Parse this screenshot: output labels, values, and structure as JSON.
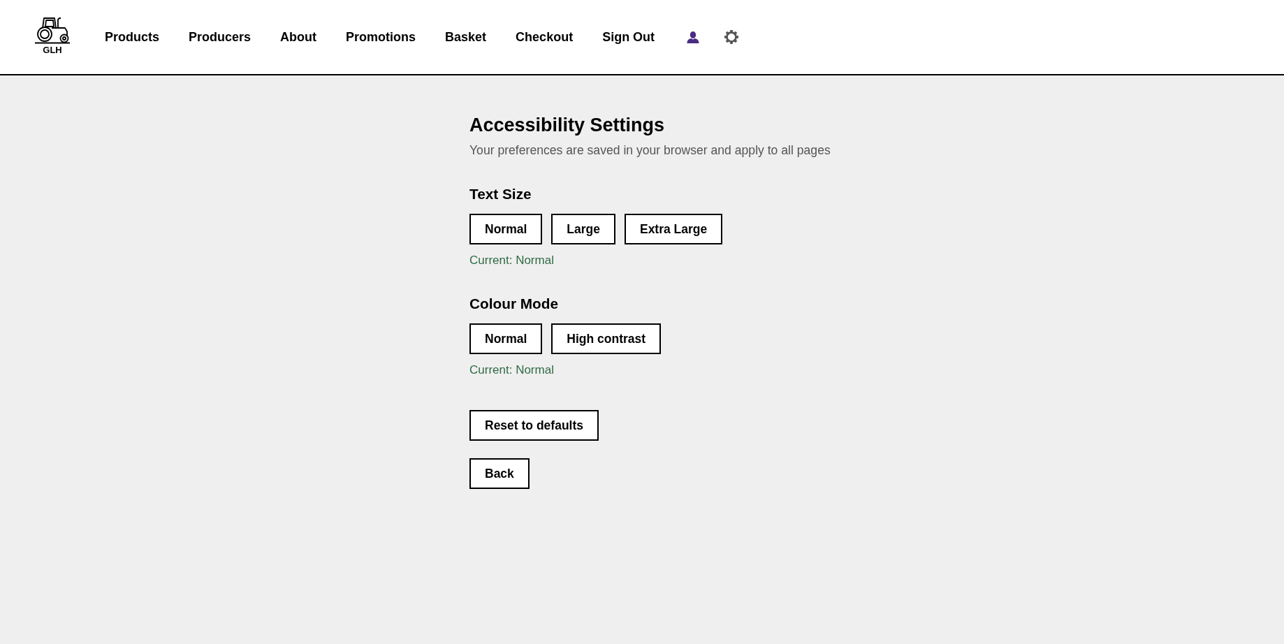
{
  "header": {
    "logo": {
      "text": "GLH"
    },
    "nav": [
      "Products",
      "Producers",
      "About",
      "Promotions",
      "Basket",
      "Checkout",
      "Sign Out"
    ]
  },
  "page": {
    "title": "Accessibility Settings",
    "subtitle": "Your preferences are saved in your browser and apply to all pages"
  },
  "sections": [
    {
      "heading": "Text Size",
      "options": [
        "Normal",
        "Large",
        "Extra Large"
      ],
      "current": "Current: Normal"
    },
    {
      "heading": "Colour Mode",
      "options": [
        "Normal",
        "High contrast"
      ],
      "current": "Current: Normal"
    }
  ],
  "actions": [
    "Reset to defaults",
    "Back"
  ]
}
